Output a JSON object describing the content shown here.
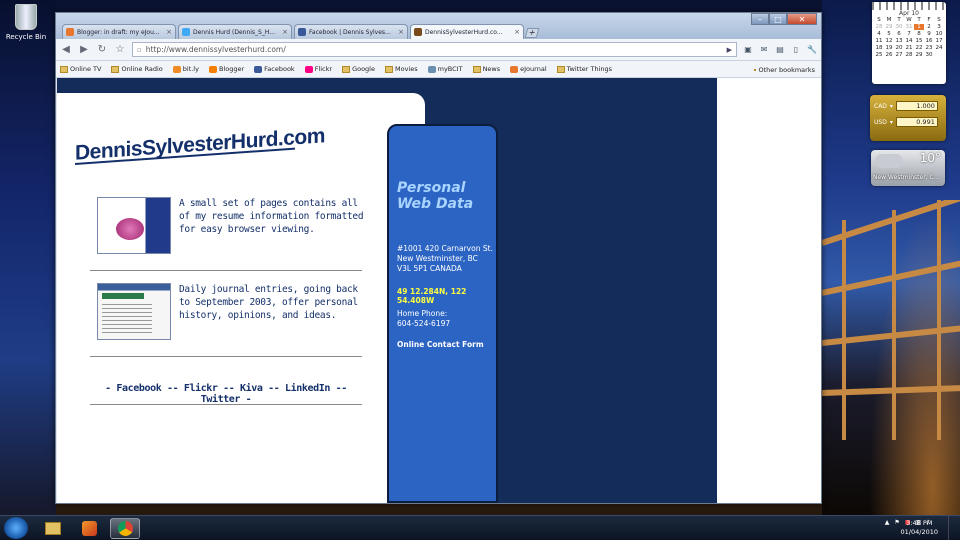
{
  "desktop": {
    "recycle_bin_label": "Recycle Bin"
  },
  "gadgets": {
    "calendar": {
      "month": "Apr 10",
      "weekdays": [
        "S",
        "M",
        "T",
        "W",
        "T",
        "F",
        "S"
      ],
      "rows": [
        [
          "28",
          "29",
          "30",
          "31",
          "1",
          "2",
          "3"
        ],
        [
          "4",
          "5",
          "6",
          "7",
          "8",
          "9",
          "10"
        ],
        [
          "11",
          "12",
          "13",
          "14",
          "15",
          "16",
          "17"
        ],
        [
          "18",
          "19",
          "20",
          "21",
          "22",
          "23",
          "24"
        ],
        [
          "25",
          "26",
          "27",
          "28",
          "29",
          "30",
          ""
        ]
      ],
      "today": "1"
    },
    "currency": {
      "row1_code": "CAD",
      "row1_value": "1.000",
      "row2_code": "USD",
      "row2_value": "0.991"
    },
    "weather": {
      "temp": "10°",
      "location": "New Westminster, C..."
    }
  },
  "browser": {
    "tabs": [
      {
        "label": "Blogger: in draft: my eJou...",
        "color": "#e8762d"
      },
      {
        "label": "Dennis Hurd (Dennis_S_H...",
        "color": "#3fa9f5"
      },
      {
        "label": "Facebook | Dennis Sylves...",
        "color": "#3b5998"
      },
      {
        "label": "DennisSylvesterHurd.co...",
        "color": "#7a4a1a"
      }
    ],
    "url": "http://www.dennissylvesterhurd.com/",
    "bookmarks": [
      {
        "label": "Online TV",
        "kind": "folder"
      },
      {
        "label": "Online Radio",
        "kind": "folder"
      },
      {
        "label": "bit.ly",
        "kind": "site"
      },
      {
        "label": "Blogger",
        "kind": "site"
      },
      {
        "label": "Facebook",
        "kind": "site"
      },
      {
        "label": "Flickr",
        "kind": "site"
      },
      {
        "label": "Google",
        "kind": "folder"
      },
      {
        "label": "Movies",
        "kind": "folder"
      },
      {
        "label": "myBCIT",
        "kind": "site"
      },
      {
        "label": "News",
        "kind": "folder"
      },
      {
        "label": "eJournal",
        "kind": "site"
      },
      {
        "label": "Twitter Things",
        "kind": "folder"
      }
    ],
    "other_bookmarks": "Other bookmarks"
  },
  "site": {
    "logo": "DennisSylvesterHurd.com",
    "entry1_text": "A small set of pages contains all of my resume information formatted for easy browser viewing.",
    "entry2_text": "Daily journal entries, going back to September 2003, offer personal history, opinions, and ideas.",
    "social": {
      "prefix": "- ",
      "sep": " -- ",
      "suffix": " -",
      "links": [
        "Facebook",
        "Flickr",
        "Kiva",
        "LinkedIn",
        "Twitter"
      ]
    },
    "sidebar": {
      "title_line1": "Personal",
      "title_line2": "Web Data",
      "addr1": "#1001 420 Carnarvon St.",
      "addr2": "New Westminster, BC",
      "addr3": "V3L 5P1   CANADA",
      "coords": "49 12.284N, 122 54.408W",
      "phone_label": "Home Phone:",
      "phone": "604-524-6197",
      "contact": "Online Contact Form"
    }
  },
  "taskbar": {
    "time": "3:48 PM",
    "date": "01/04/2010"
  }
}
